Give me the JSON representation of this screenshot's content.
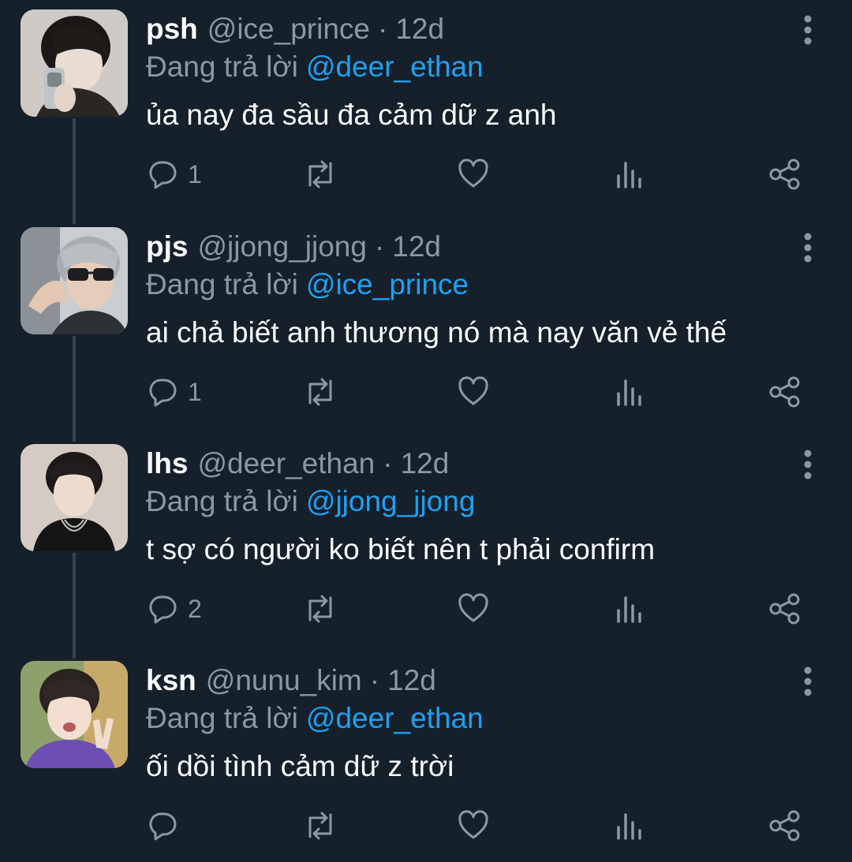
{
  "reply_prefix": "Đang trả lời",
  "tweets": [
    {
      "name": "psh",
      "handle": "@ice_prince",
      "time": "12d",
      "replying_to": "@deer_ethan",
      "text": "ủa nay đa sầu đa cảm dữ z anh",
      "reply_count": "1",
      "avatar": "selfie-phone"
    },
    {
      "name": "pjs",
      "handle": "@jjong_jjong",
      "time": "12d",
      "replying_to": "@ice_prince",
      "text": "ai chả biết anh thương nó mà nay văn vẻ thế",
      "reply_count": "1",
      "avatar": "sunglasses"
    },
    {
      "name": "lhs",
      "handle": "@deer_ethan",
      "time": "12d",
      "replying_to": "@jjong_jjong",
      "text": "t sợ có người ko biết nên t phải confirm",
      "reply_count": "2",
      "avatar": "black-shirt"
    },
    {
      "name": "ksn",
      "handle": "@nunu_kim",
      "time": "12d",
      "replying_to": "@deer_ethan",
      "text": "ối dồi tình cảm dữ z trời",
      "reply_count": "",
      "avatar": "peace-sign"
    }
  ],
  "icons": [
    "reply-icon",
    "retweet-icon",
    "like-icon",
    "analytics-icon",
    "share-icon",
    "more-icon"
  ],
  "colors": {
    "background": "#15202b",
    "secondary_text": "#8899a6",
    "mention": "#1da1f2",
    "thread_line": "#38444d"
  }
}
